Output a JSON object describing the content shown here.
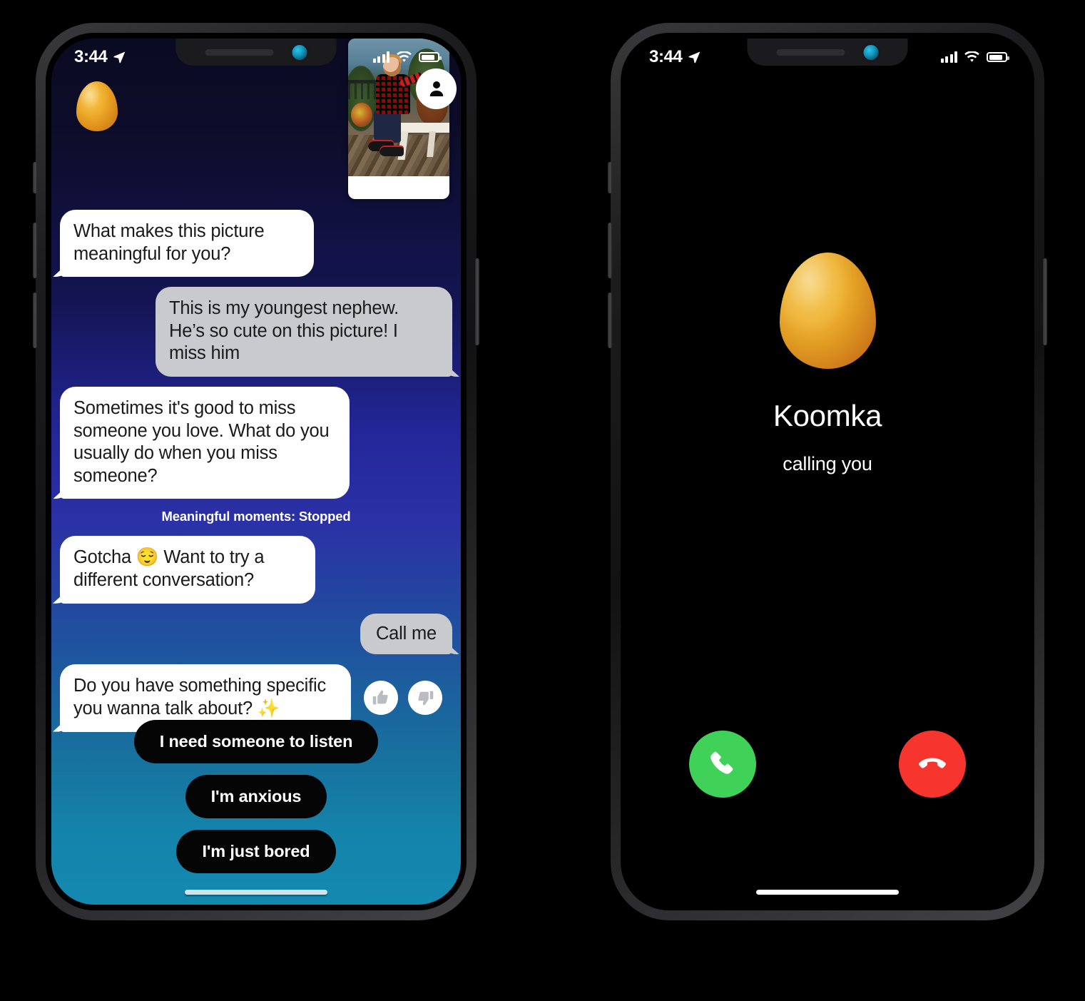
{
  "phones": {
    "left": {
      "status_bar": {
        "time": "3:44",
        "location_icon": "location-arrow-icon",
        "signal_icon": "cellular-signal-icon",
        "wifi_icon": "wifi-icon",
        "battery_icon": "battery-icon"
      },
      "header": {
        "avatar_name": "egg-avatar",
        "photo_caption": "shared photo of a young boy in a red plaid shirt sitting on a white bench",
        "profile_button_icon": "person-icon"
      },
      "messages": [
        {
          "side": "in",
          "text": "What makes this picture meaningful for you?"
        },
        {
          "side": "out",
          "text": "This is my youngest nephew. He’s so cute on this picture! I miss him"
        },
        {
          "side": "in",
          "text": "Sometimes it's good to miss someone you love. What do you usually do when you miss someone?"
        }
      ],
      "system_note": "Meaningful moments: Stopped",
      "messages2": [
        {
          "side": "in",
          "text": "Gotcha 😌 Want to try a different conversation?"
        },
        {
          "side": "out",
          "text": "Call me"
        }
      ],
      "feedback_message": {
        "text": "Do you have something specific you wanna talk about? ✨",
        "thumbs_up_icon": "thumbs-up-icon",
        "thumbs_down_icon": "thumbs-down-icon"
      },
      "quick_replies": [
        "I need someone to listen",
        "I'm anxious",
        "I'm just bored"
      ]
    },
    "right": {
      "status_bar": {
        "time": "3:44",
        "location_icon": "location-arrow-icon",
        "signal_icon": "cellular-signal-icon",
        "wifi_icon": "wifi-icon",
        "battery_icon": "battery-icon"
      },
      "call": {
        "avatar_name": "egg-avatar",
        "caller_name": "Koomka",
        "status_text": "calling you",
        "accept_label": "accept-call",
        "decline_label": "decline-call",
        "accept_color": "#3fd158",
        "decline_color": "#f6352e"
      }
    }
  }
}
